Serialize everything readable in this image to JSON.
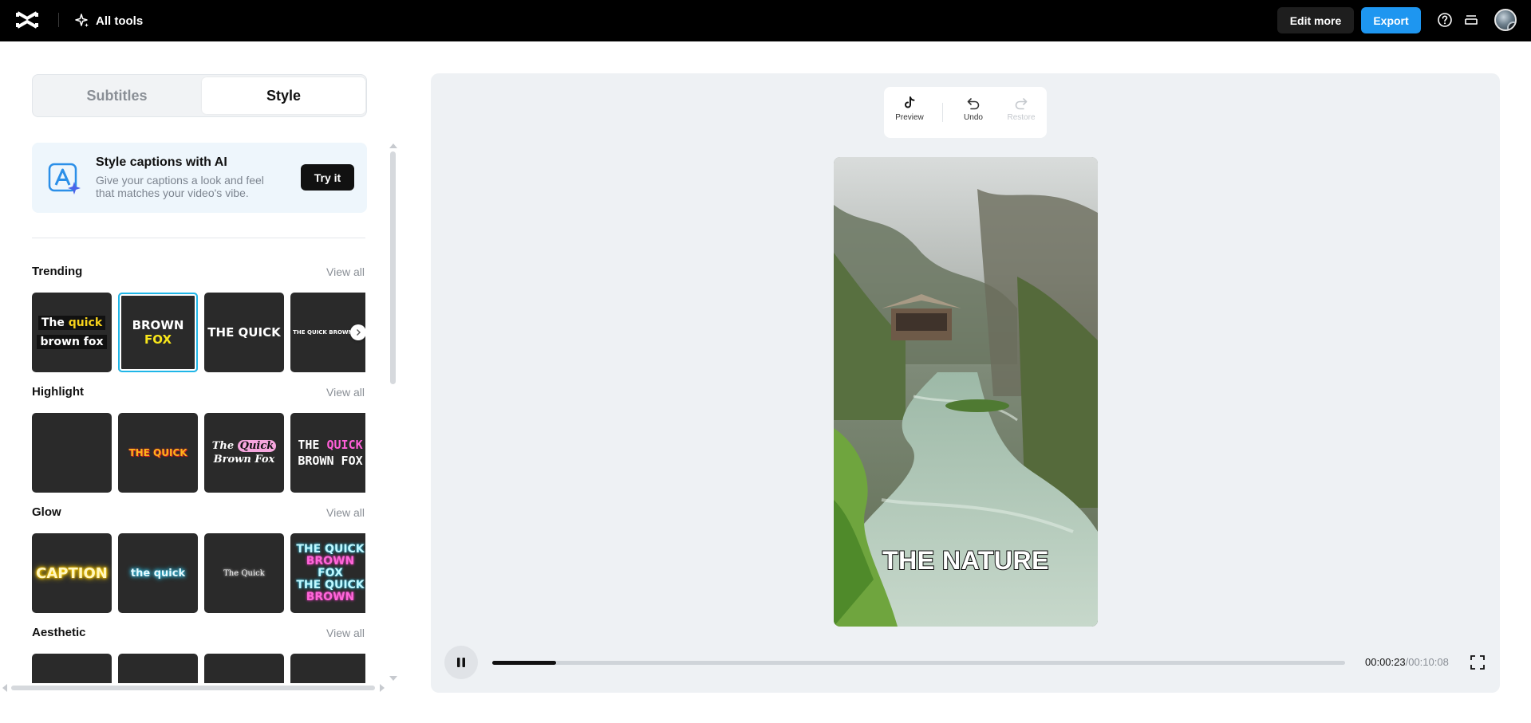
{
  "colors": {
    "topbar_bg": "#000000",
    "accent": "#1e96f0",
    "selection": "#1fb6e8",
    "panel_bg": "#eef1f4"
  },
  "topbar": {
    "logo_icon": "capcut-logo-icon",
    "all_tools_label": "All tools",
    "edit_more_label": "Edit more",
    "export_label": "Export",
    "icons": [
      "help-icon",
      "menu-drawer-icon",
      "avatar"
    ]
  },
  "tabs": [
    {
      "label": "Subtitles",
      "active": false
    },
    {
      "label": "Style",
      "active": true
    }
  ],
  "ai_card": {
    "title": "Style captions with AI",
    "description": "Give your captions a look and feel that matches your video's vibe.",
    "button_label": "Try it"
  },
  "sections": {
    "trending": {
      "title": "Trending",
      "view_all": "View all",
      "tiles": [
        {
          "line1_a": "The ",
          "line1_b": "quick",
          "line2": "brown fox"
        },
        {
          "a": "BROWN ",
          "b": "FOX",
          "selected": true
        },
        {
          "text": "THE QUICK"
        },
        {
          "text": "THE QUICK BROWN FOX"
        }
      ]
    },
    "highlight": {
      "title": "Highlight",
      "view_all": "View all",
      "tiles": [
        {
          "text": ""
        },
        {
          "text": "THE QUICK"
        },
        {
          "a": "The ",
          "b": "Quick",
          "line2": "Brown Fox"
        },
        {
          "a": "THE ",
          "b": "QUICK",
          "line2": "BROWN FOX"
        }
      ]
    },
    "glow": {
      "title": "Glow",
      "view_all": "View all",
      "tiles": [
        {
          "text": "CAPTION"
        },
        {
          "text": "the quick"
        },
        {
          "text": "The Quick"
        },
        {
          "l1": "THE QUICK",
          "l2": "BROWN",
          "l3": "FOX",
          "l4": "THE QUICK",
          "l5": "BROWN"
        }
      ]
    },
    "aesthetic": {
      "title": "Aesthetic",
      "view_all": "View all"
    }
  },
  "preview_toolbar": [
    {
      "label": "Preview",
      "icon": "tiktok-icon",
      "enabled": true
    },
    {
      "label": "Undo",
      "icon": "undo-icon",
      "enabled": true
    },
    {
      "label": "Restore",
      "icon": "redo-icon",
      "enabled": false
    }
  ],
  "video": {
    "caption": "THE NATURE",
    "scene": "misty river valley with gazebo"
  },
  "player": {
    "current_time": "00:00:23",
    "total_time": "/00:10:08",
    "progress": 0.075,
    "state_icon": "pause-icon"
  }
}
